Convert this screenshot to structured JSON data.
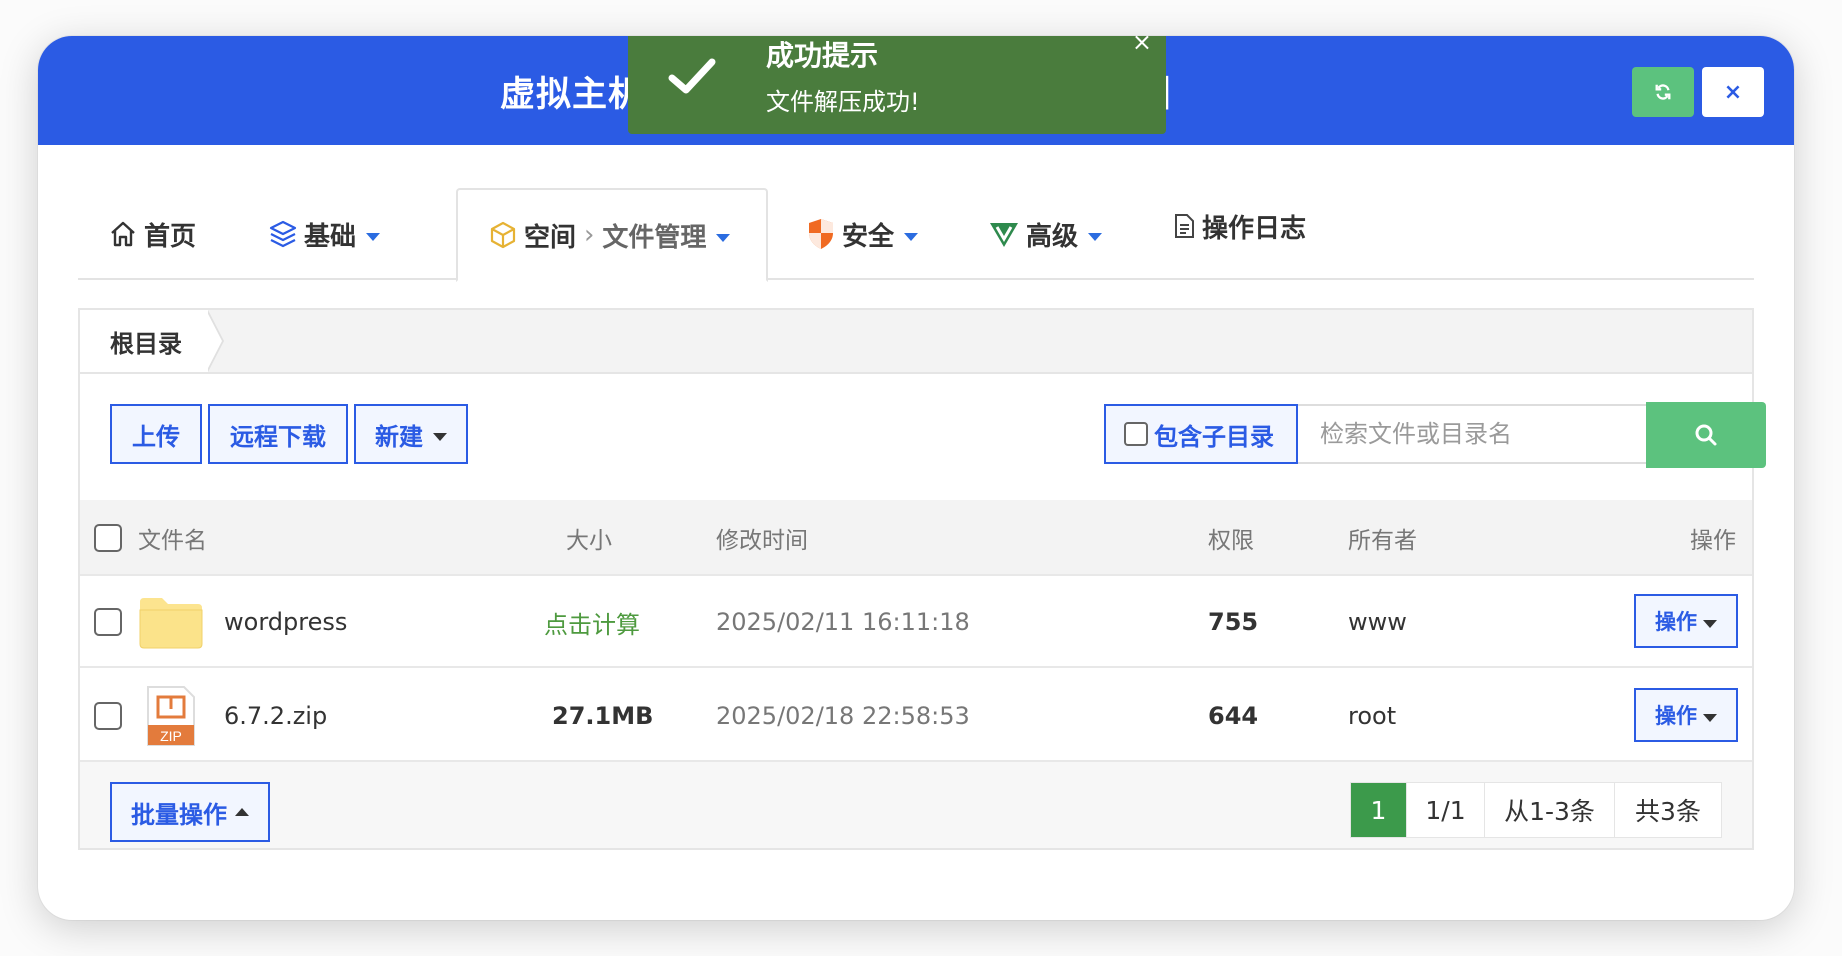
{
  "window": {
    "title": "虚拟主机面",
    "title_tail": "】",
    "refresh_icon": "refresh-icon",
    "close_icon": "close-icon",
    "close_glyph": "×",
    "refresh_glyph": "⟳"
  },
  "toast": {
    "title": "成功提示",
    "message": "文件解压成功!",
    "close_glyph": "×"
  },
  "tabs": [
    {
      "label": "首页",
      "icon": "home-icon"
    },
    {
      "label": "基础",
      "icon": "layers-icon",
      "dropdown": true
    },
    {
      "label": "空间",
      "sub": "文件管理",
      "sep": "›",
      "icon": "box-icon",
      "dropdown": true,
      "active": true
    },
    {
      "label": "安全",
      "icon": "shield-icon",
      "dropdown": true
    },
    {
      "label": "高级",
      "icon": "v-badge-icon",
      "dropdown": true
    },
    {
      "label": "操作日志",
      "icon": "document-icon"
    }
  ],
  "breadcrumb": {
    "root": "根目录"
  },
  "toolbar": {
    "upload": "上传",
    "remote_download": "远程下载",
    "new": "新建",
    "include_subdir": "包含子目录",
    "search_placeholder": "检索文件或目录名"
  },
  "table": {
    "headers": {
      "name": "文件名",
      "size": "大小",
      "mtime": "修改时间",
      "perm": "权限",
      "owner": "所有者",
      "ops": "操作"
    },
    "rows": [
      {
        "name": "wordpress",
        "type": "folder",
        "size": "点击计算",
        "mtime": "2025/02/11 16:11:18",
        "perm": "755",
        "owner": "www",
        "op": "操作"
      },
      {
        "name": "6.7.2.zip",
        "type": "zip",
        "size": "27.1MB",
        "mtime": "2025/02/18 22:58:53",
        "perm": "644",
        "owner": "root",
        "op": "操作"
      }
    ]
  },
  "footer": {
    "batch": "批量操作",
    "pager": {
      "current": "1",
      "pages": "1/1",
      "range": "从1-3条",
      "total": "共3条"
    }
  },
  "colors": {
    "brand": "#2b5be4",
    "success": "#4a7c3d",
    "green_btn": "#5cc27e",
    "pager_active": "#3c9a4b",
    "calc_link": "#4e9a3f"
  }
}
